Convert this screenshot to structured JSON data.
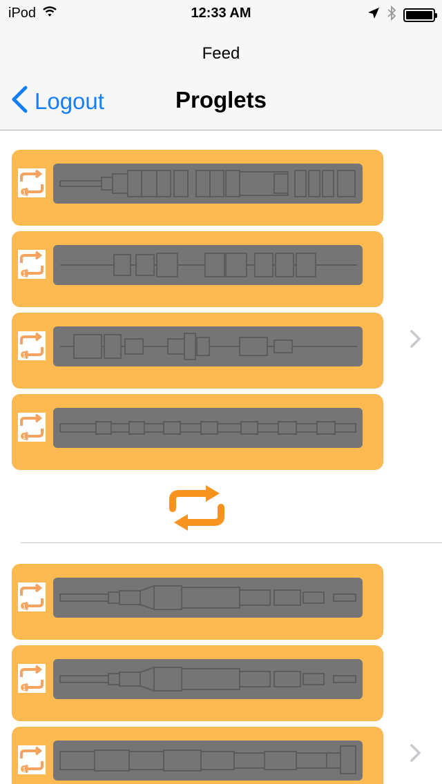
{
  "status_bar": {
    "carrier": "iPod",
    "time": "12:33 AM"
  },
  "nav": {
    "prompt": "Feed",
    "back_label": "Logout",
    "title": "Proglets"
  },
  "colors": {
    "card": "#fcb952",
    "thumb": "#757575",
    "accent": "#157efb",
    "repost": "#f7931e",
    "repost_small": "#f4a460"
  },
  "icons": {
    "repost": "repost-icon",
    "chevron": "chevron-right-icon",
    "back": "chevron-left-icon"
  },
  "feed_groups": [
    {
      "proglet_count": 4
    },
    {
      "proglet_count": 3
    }
  ]
}
